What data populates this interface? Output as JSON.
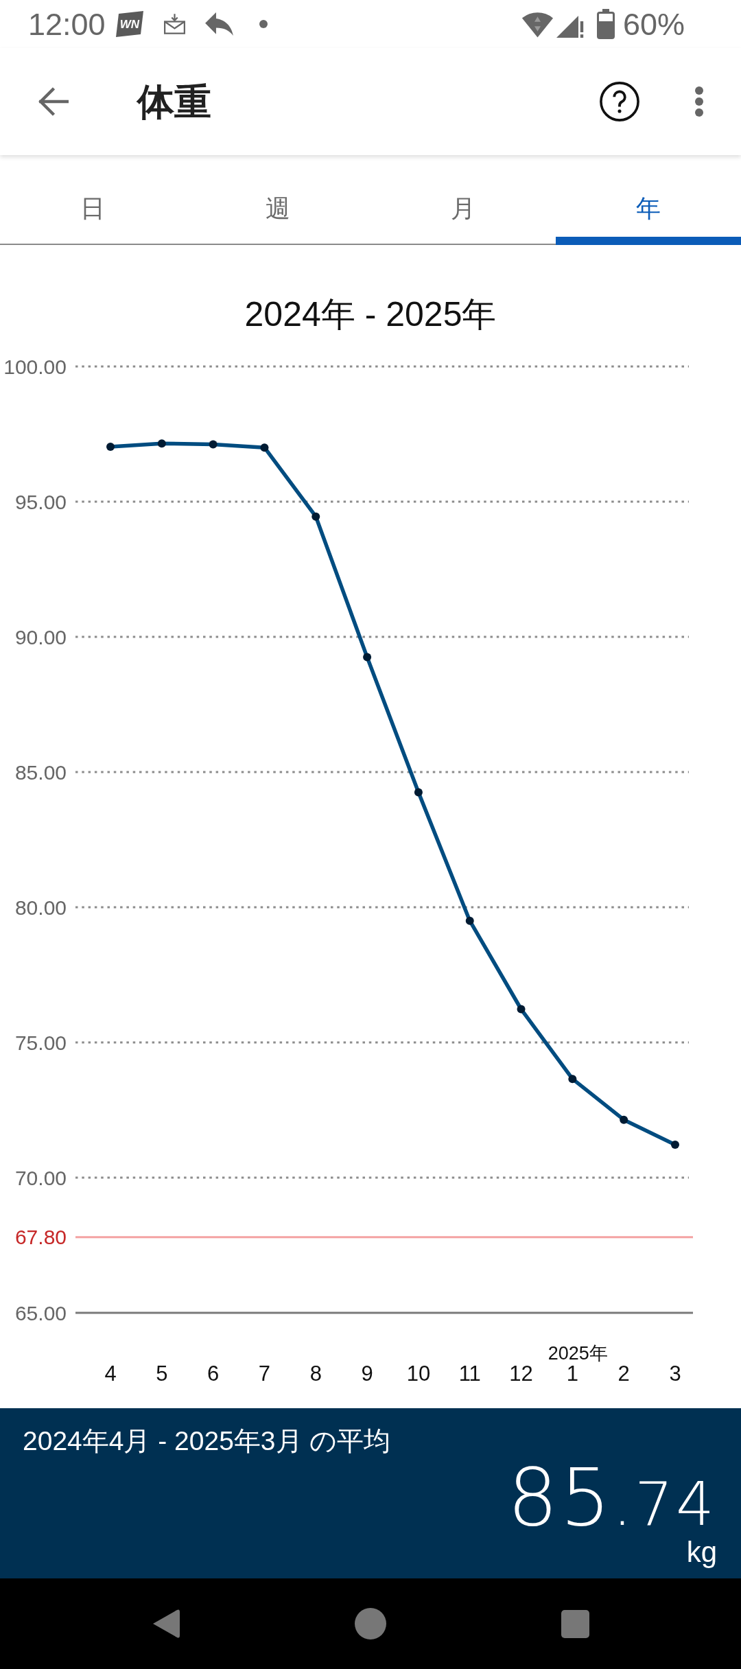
{
  "status_bar": {
    "time": "12:00",
    "logo_text": "WN",
    "battery": "60%"
  },
  "app_bar": {
    "title": "体重"
  },
  "tabs": [
    {
      "label": "日",
      "selected": false
    },
    {
      "label": "週",
      "selected": false
    },
    {
      "label": "月",
      "selected": false
    },
    {
      "label": "年",
      "selected": true
    }
  ],
  "chart": {
    "chart_data": {
      "type": "line",
      "title": "2024年 - 2025年",
      "categories": [
        "4",
        "5",
        "6",
        "7",
        "8",
        "9",
        "10",
        "11",
        "12",
        "2025年\n1",
        "2",
        "3"
      ],
      "series": [
        {
          "color": "#004c80",
          "marker": "circle",
          "values": [
            97.03,
            97.15,
            97.12,
            97.0,
            94.45,
            89.25,
            84.25,
            79.5,
            76.23,
            73.65,
            72.14,
            71.22
          ]
        }
      ],
      "ylim": [
        65,
        100
      ],
      "yticks": [
        {
          "value": 65,
          "label": "65.00"
        },
        {
          "value": 70,
          "label": "70.00"
        },
        {
          "value": 75,
          "label": "75.00"
        },
        {
          "value": 80,
          "label": "80.00"
        },
        {
          "value": 85,
          "label": "85.00"
        },
        {
          "value": 90,
          "label": "90.00"
        },
        {
          "value": 95,
          "label": "95.00"
        },
        {
          "value": 100,
          "label": "100.00"
        }
      ],
      "grid": true,
      "ref_lines": [
        {
          "axis": "y",
          "value": 67.8,
          "label": "67.80",
          "color": "#f4a3a3"
        }
      ]
    }
  },
  "average": {
    "label": "2024年4月 - 2025年3月 の平均",
    "value": "85.74",
    "unit": "kg"
  }
}
